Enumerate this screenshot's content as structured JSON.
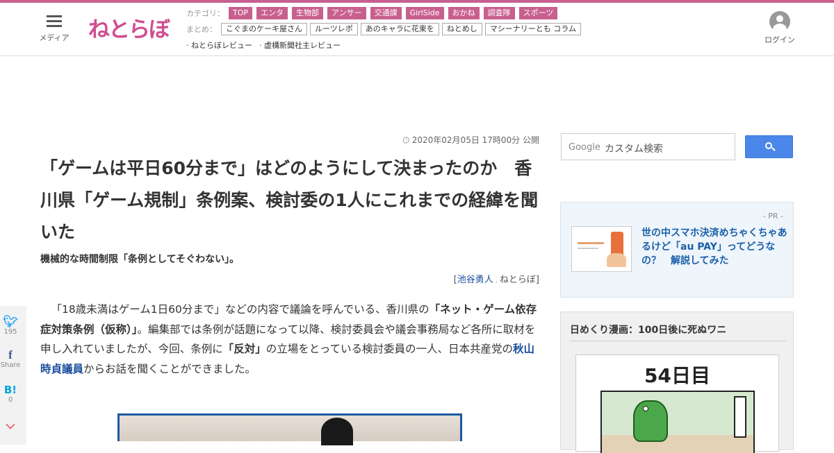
{
  "header": {
    "menu_label": "メディア",
    "logo_text": "ねとらぼ",
    "category_label": "カテゴリ：",
    "categories": [
      "TOP",
      "エンタ",
      "生物部",
      "アンサー",
      "交通課",
      "GirlSide",
      "おかね",
      "調査隊",
      "スポーツ"
    ],
    "summary_label": "まとめ：",
    "summaries": [
      "こぐまのケーキ屋さん",
      "ルーツレポ",
      "あのキャラに花束を",
      "ねとめし",
      "マシーナリーとも コラム"
    ],
    "reviews": [
      "· ねとらぼレビュー",
      "· 虚構新聞社主レビュー"
    ],
    "login_label": "ログイン",
    "accent_color": "#c8608f"
  },
  "article": {
    "published": "2020年02月05日 17時00分 公開",
    "title": "「ゲームは平日60分まで」はどのようにして決まったのか　香川県「ゲーム規制」条例案、検討委の1人にこれまでの経緯を聞いた",
    "lead": "機械的な時間制限「条例としてそぐわない」。",
    "byline": {
      "open": "[",
      "author": "池谷勇人",
      "sep": ",",
      "site": "ねとらぼ",
      "close": "]"
    },
    "body": {
      "p1": "「18歳未満はゲーム1日60分まで」などの内容で議論を呼んでいる、香川県の",
      "b1": "「ネット・ゲーム依存症対策条例（仮称）」",
      "p2": "。編集部では条例が話題になって以降、検討委員会や議会事務局など各所に取材を申し入れていましたが、今回、条例に",
      "b2": "「反対」",
      "p3": "の立場をとっている検討委員の一人、日本共産党の",
      "link": "秋山時貞議員",
      "p4": "からお話を聞くことができました。"
    }
  },
  "social": {
    "twitter_count": "195",
    "facebook_label": "Share",
    "hatena_count": "0"
  },
  "sidebar": {
    "search_brand": "Google",
    "search_placeholder": "カスタム検索",
    "pr_label": "- PR -",
    "pr_text": "世の中スマホ決済めちゃくちゃあるけど「au PAY」ってどうなの？　解説してみた",
    "comic_title": "日めくり漫画：100日後に死ぬワニ",
    "comic_day": "54日目"
  }
}
